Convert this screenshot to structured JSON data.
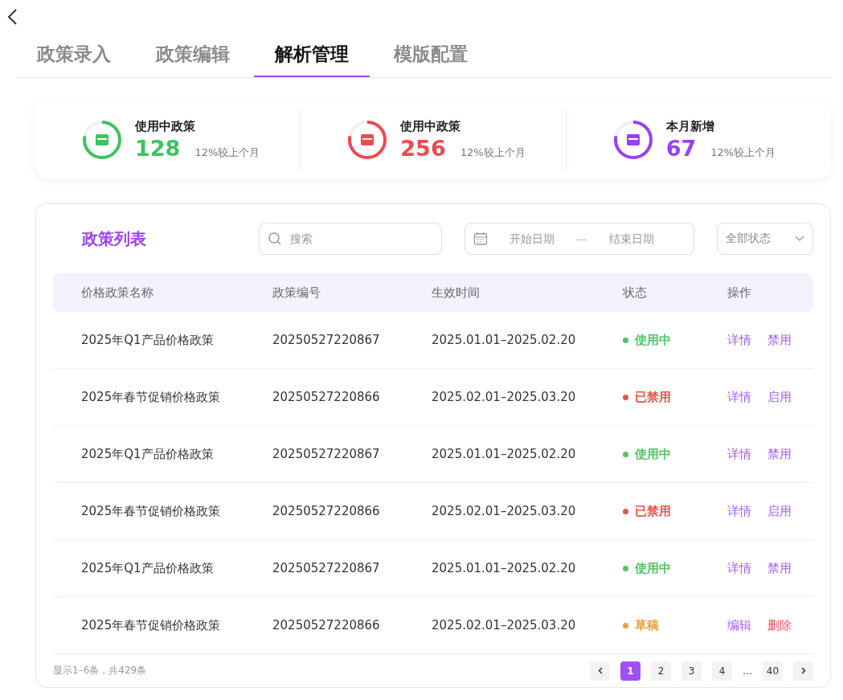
{
  "tabs": [
    {
      "label": "政策录入",
      "selected": false
    },
    {
      "label": "政策编辑",
      "selected": false
    },
    {
      "label": "解析管理",
      "selected": true
    },
    {
      "label": "模版配置",
      "selected": false
    }
  ],
  "stats": [
    {
      "title": "使用中政策",
      "value": "128",
      "change": "12%较上个月",
      "color": "#3fc35e"
    },
    {
      "title": "使用中政策",
      "value": "256",
      "change": "12%较上个月",
      "color": "#f2484f"
    },
    {
      "title": "本月新增",
      "value": "67",
      "change": "12%较上个月",
      "color": "#9b3ff5"
    }
  ],
  "list": {
    "title": "政策列表",
    "search": {
      "placeholder": "搜索"
    },
    "date_range": {
      "start_placeholder": "开始日期",
      "separator": "—",
      "end_placeholder": "结束日期"
    },
    "status_filter": "全部状态"
  },
  "table": {
    "columns": [
      "价格政策名称",
      "政策编号",
      "生效时间",
      "状态",
      "操作"
    ],
    "rows": [
      {
        "name": "2025年Q1产品价格政策",
        "code": "20250527220867",
        "period": "2025.01.01–2025.02.20",
        "status": "使用中",
        "color": "#52c463",
        "actions": [
          {
            "label": "详情",
            "kind": "normal"
          },
          {
            "label": "禁用",
            "kind": "normal"
          }
        ]
      },
      {
        "name": "2025年春节促销价格政策",
        "code": "20250527220866",
        "period": "2025.02.01–2025.03.20",
        "status": "已禁用",
        "color": "#e5534b",
        "actions": [
          {
            "label": "详情",
            "kind": "normal"
          },
          {
            "label": "启用",
            "kind": "normal"
          }
        ]
      },
      {
        "name": "2025年Q1产品价格政策",
        "code": "20250527220867",
        "period": "2025.01.01–2025.02.20",
        "status": "使用中",
        "color": "#52c463",
        "actions": [
          {
            "label": "详情",
            "kind": "normal"
          },
          {
            "label": "禁用",
            "kind": "normal"
          }
        ]
      },
      {
        "name": "2025年春节促销价格政策",
        "code": "20250527220866",
        "period": "2025.02.01–2025.03.20",
        "status": "已禁用",
        "color": "#e5534b",
        "actions": [
          {
            "label": "详情",
            "kind": "normal"
          },
          {
            "label": "启用",
            "kind": "normal"
          }
        ]
      },
      {
        "name": "2025年Q1产品价格政策",
        "code": "20250527220867",
        "period": "2025.01.01–2025.02.20",
        "status": "使用中",
        "color": "#52c463",
        "actions": [
          {
            "label": "详情",
            "kind": "normal"
          },
          {
            "label": "禁用",
            "kind": "normal"
          }
        ]
      },
      {
        "name": "2025年春节促销价格政策",
        "code": "20250527220866",
        "period": "2025.02.01–2025.03.20",
        "status": "草稿",
        "color": "#e9a23b",
        "actions": [
          {
            "label": "编辑",
            "kind": "normal"
          },
          {
            "label": "删除",
            "kind": "danger"
          }
        ]
      }
    ]
  },
  "pagination": {
    "summary": "显示1–6条，共429条",
    "pages": [
      {
        "label": "1",
        "selected": true
      },
      {
        "label": "2",
        "selected": false
      },
      {
        "label": "3",
        "selected": false
      },
      {
        "label": "4",
        "selected": false
      },
      {
        "label": "…",
        "kind": "ellipsis"
      },
      {
        "label": "40",
        "selected": false
      }
    ]
  }
}
